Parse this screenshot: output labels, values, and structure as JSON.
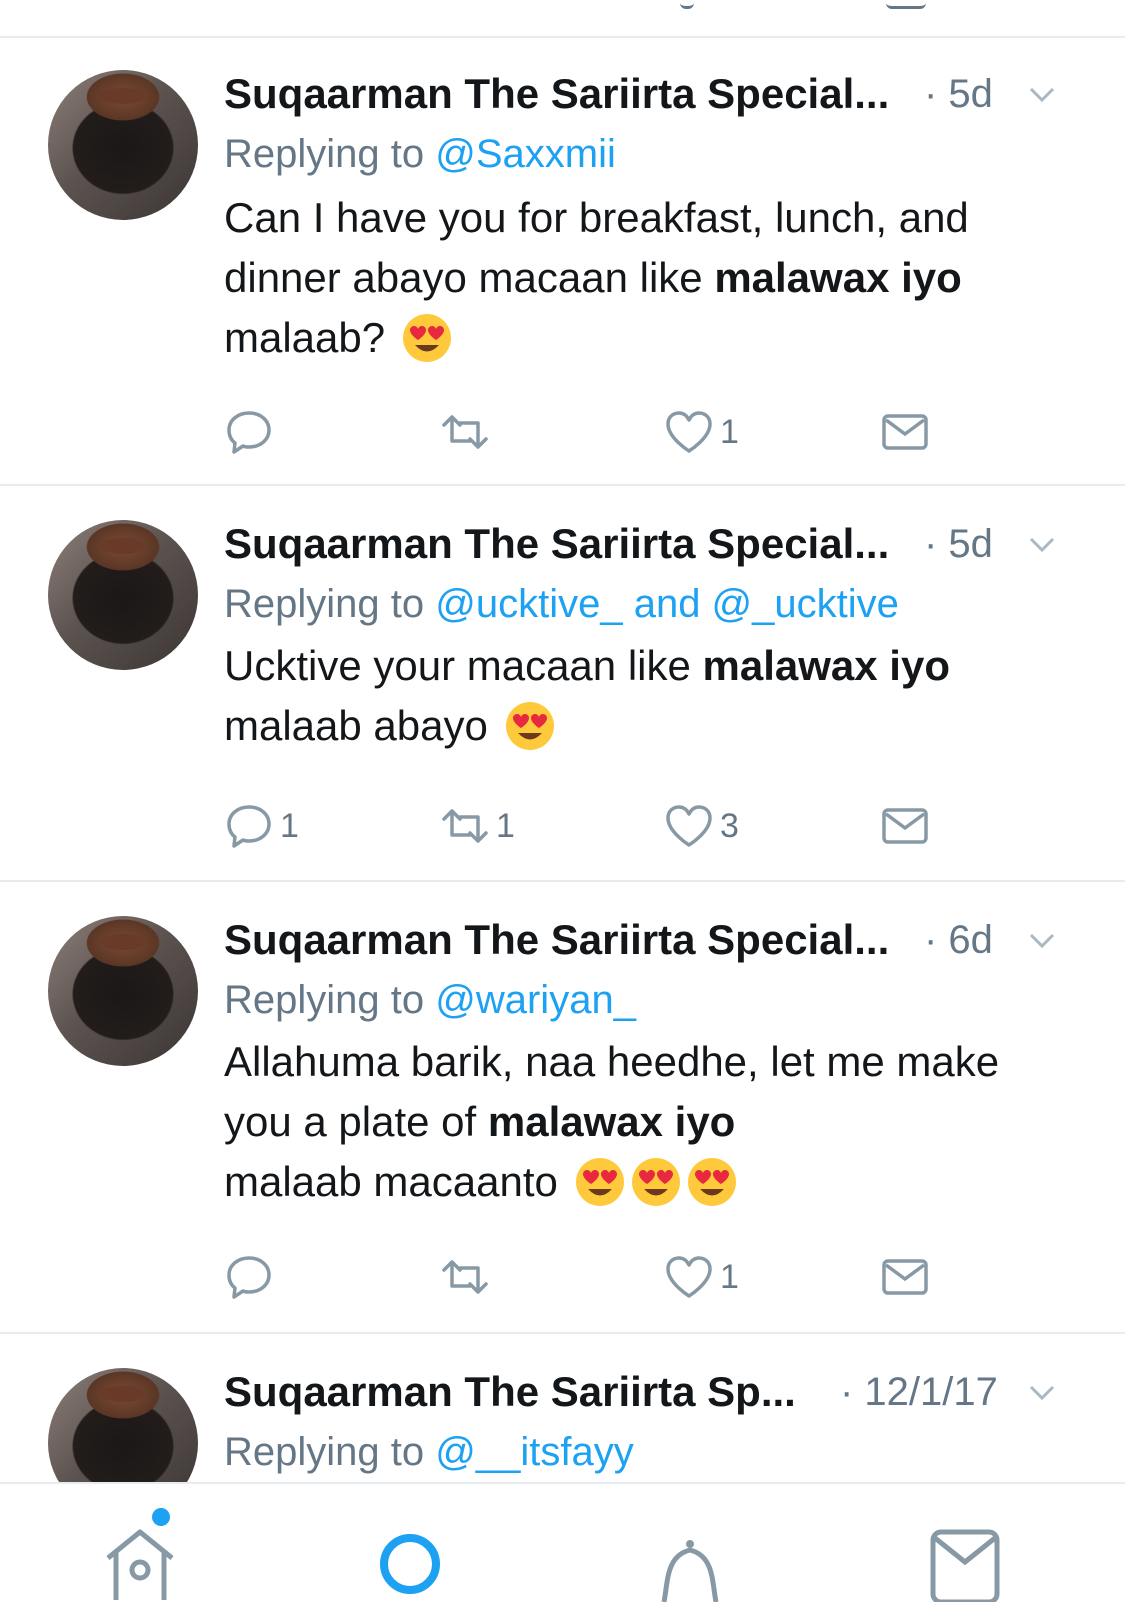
{
  "tweets": [
    {
      "name": "Suqaarman The Sariirta Special...",
      "time": "· 5d",
      "replying_prefix": "Replying to",
      "replying_to": "@Saxxmii",
      "text_parts": [
        "Can I have you for breakfast, lunch, and dinner abayo macaan like ",
        "malawax iyo",
        " malaab?"
      ],
      "emoji_count": 1,
      "reply_count": "",
      "retweet_count": "",
      "like_count": "1"
    },
    {
      "name": "Suqaarman The Sariirta Special...",
      "time": "· 5d",
      "replying_prefix": "Replying to",
      "replying_to": "@ucktive_ and @_ucktive",
      "text_parts": [
        "Ucktive your macaan like ",
        "malawax iyo",
        " malaab abayo"
      ],
      "emoji_count": 1,
      "reply_count": "1",
      "retweet_count": "1",
      "like_count": "3"
    },
    {
      "name": "Suqaarman The Sariirta Special...",
      "time": "· 6d",
      "replying_prefix": "Replying to",
      "replying_to": "@wariyan_",
      "text_parts": [
        "Allahuma barik, naa heedhe, let me make you a plate of ",
        "malawax iyo",
        " malaab macaanto"
      ],
      "emoji_count": 3,
      "reply_count": "",
      "retweet_count": "",
      "like_count": "1"
    },
    {
      "name": "Suqaarman The Sariirta Sp...",
      "time": "· 12/1/17",
      "replying_prefix": "Replying to",
      "replying_to": "@__itsfayy"
    }
  ],
  "icons": {
    "reply": "reply-icon",
    "retweet": "retweet-icon",
    "like": "heart-icon",
    "dm": "envelope-icon",
    "caret": "chevron-down-icon",
    "emoji": "heart-eyes-emoji-icon"
  },
  "tabbar": {
    "items": [
      "home-icon",
      "search-icon",
      "notifications-icon",
      "messages-icon"
    ],
    "home_has_new_dot": true
  },
  "colors": {
    "accent": "#1da1f2",
    "secondary_text": "#657786",
    "divider": "#e6ecf0"
  }
}
